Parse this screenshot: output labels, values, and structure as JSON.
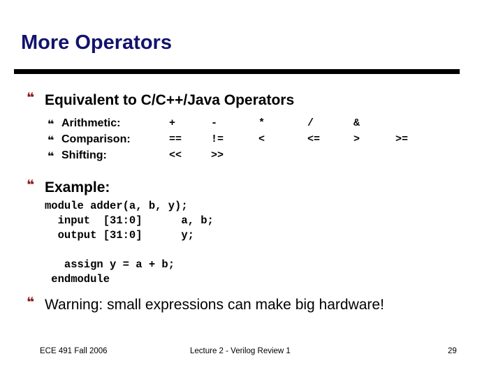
{
  "slide": {
    "title": "More Operators",
    "colors": {
      "title": "#13126b",
      "rule": "#000000",
      "bullet_level1": "#8b1a1a",
      "bullet_level2": "#13126b",
      "body_text": "#000000",
      "background": "#ffffff"
    },
    "bullet_glyph": "❝",
    "bullets": [
      {
        "id": "equivalent",
        "text": "Equivalent to C/C++/Java Operators"
      },
      {
        "id": "example",
        "text": "Example:"
      },
      {
        "id": "warning",
        "text": "Warning: small expressions can make big hardware!"
      }
    ],
    "operators": {
      "rows": [
        {
          "label": "Arithmetic:",
          "ops": [
            "+",
            "-",
            "*",
            "/",
            "&",
            ""
          ]
        },
        {
          "label": "Comparison:",
          "ops": [
            "==",
            "!=",
            "<",
            "<=",
            ">",
            ">="
          ]
        },
        {
          "label": "Shifting:",
          "ops": [
            "<<",
            ">>",
            "",
            "",
            "",
            ""
          ]
        }
      ]
    },
    "code": "module adder(a, b, y);\n  input  [31:0]      a, b;\n  output [31:0]      y;\n\n   assign y = a + b;\n endmodule"
  },
  "footer": {
    "left": "ECE 491 Fall 2006",
    "center": "Lecture 2 - Verilog Review 1",
    "right": "29"
  }
}
